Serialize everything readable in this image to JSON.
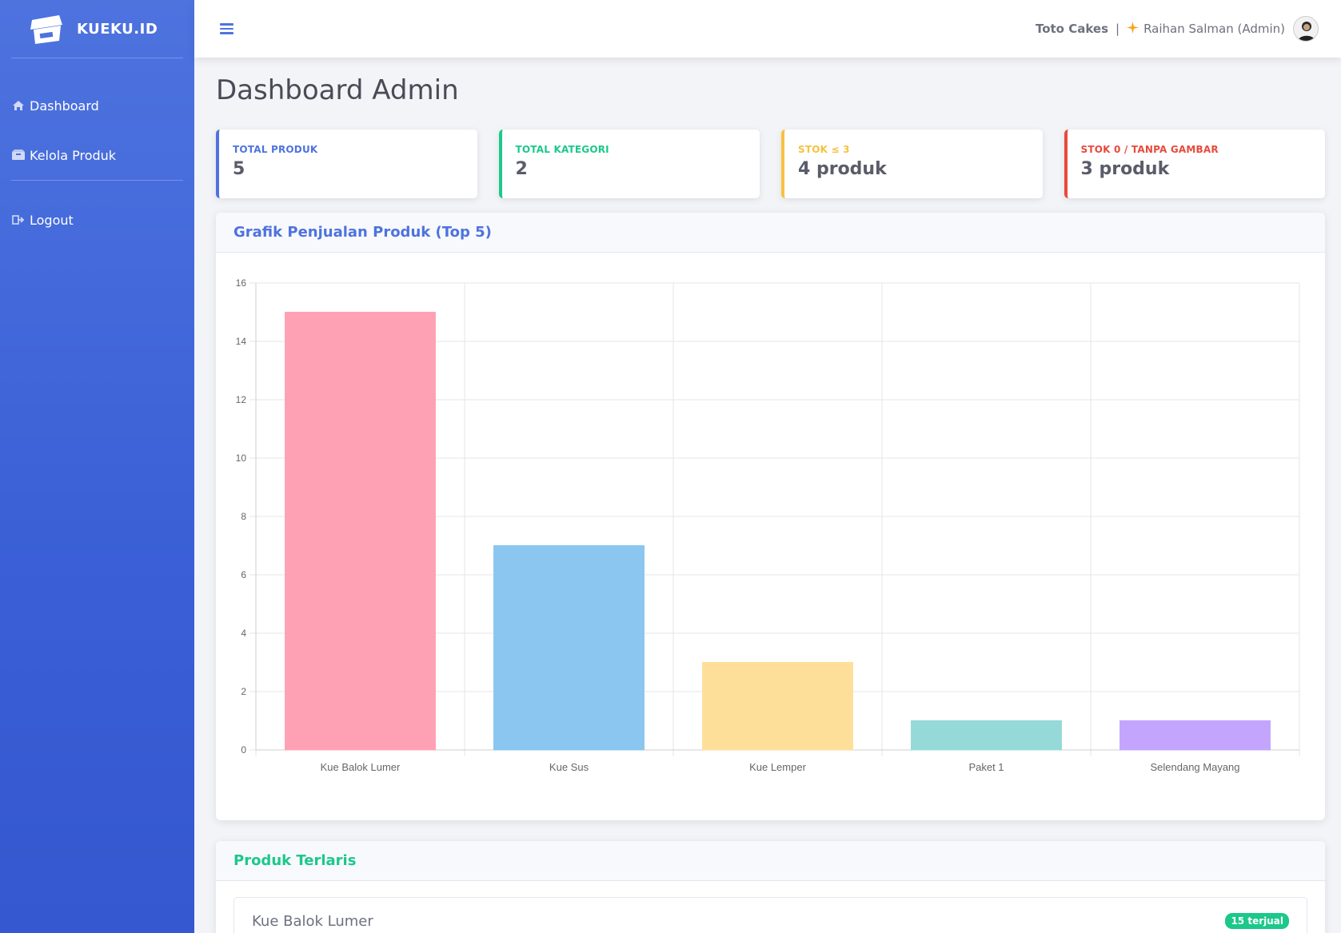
{
  "brand": {
    "name": "KUEKU.ID"
  },
  "sidebar": {
    "items": [
      {
        "label": "Dashboard",
        "icon": "home-icon"
      },
      {
        "label": "Kelola Produk",
        "icon": "box-icon"
      },
      {
        "label": "Logout",
        "icon": "logout-icon"
      }
    ]
  },
  "topbar": {
    "shop_name": "Toto Cakes",
    "separator": "|",
    "user_label": "Raihan Salman (Admin)"
  },
  "page": {
    "title": "Dashboard Admin"
  },
  "stats": [
    {
      "label": "Total Produk",
      "value": "5",
      "color": "#4e73df"
    },
    {
      "label": "Total Kategori",
      "value": "2",
      "color": "#1cc88a"
    },
    {
      "label": "Stok ≤ 3",
      "value": "4 produk",
      "color": "#f6c23e"
    },
    {
      "label": "Stok 0 / Tanpa Gambar",
      "value": "3 produk",
      "color": "#e74a3b"
    }
  ],
  "chart_panel": {
    "title": "Grafik Penjualan Produk (Top 5)",
    "title_color": "#4e73df"
  },
  "chart_data": {
    "type": "bar",
    "title": "",
    "xlabel": "",
    "ylabel": "",
    "categories": [
      "Kue Balok Lumer",
      "Kue Sus",
      "Kue Lemper",
      "Paket 1",
      "Selendang Mayang"
    ],
    "values": [
      15,
      7,
      3,
      1,
      1
    ],
    "colors": [
      "#ffa1b4",
      "#8ac6f0",
      "#fedf9a",
      "#95d9d8",
      "#c3a5fd"
    ],
    "ylim": [
      0,
      16
    ],
    "yticks": [
      0,
      2,
      4,
      6,
      8,
      10,
      12,
      14,
      16
    ],
    "grid": true
  },
  "best_sellers": {
    "title": "Produk Terlaris",
    "title_color": "#1cc88a",
    "items": [
      {
        "name": "Kue Balok Lumer",
        "badge": "15 terjual"
      }
    ]
  }
}
